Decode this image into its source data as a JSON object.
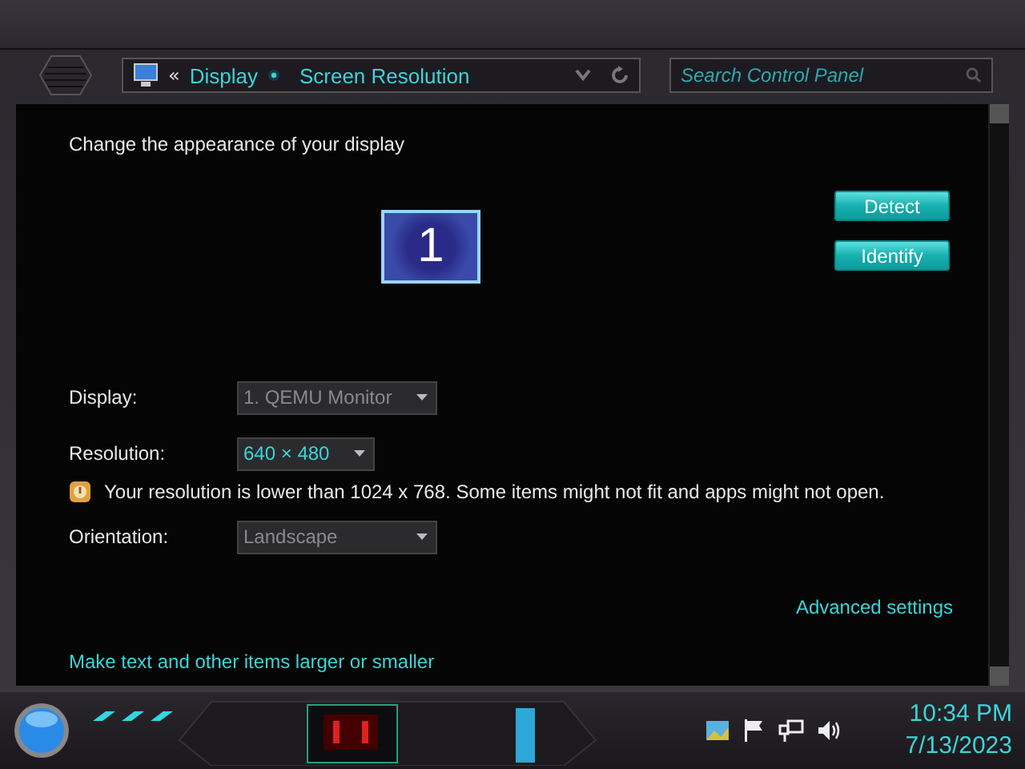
{
  "address_bar": {
    "back_glyph": "«",
    "breadcrumbs": [
      {
        "label": "Display"
      },
      {
        "label": "Screen Resolution"
      }
    ]
  },
  "search": {
    "placeholder": "Search Control Panel"
  },
  "content": {
    "heading": "Change the appearance of your display",
    "monitor": {
      "label": "1",
      "selected": true
    },
    "buttons": [
      "Detect",
      "Identify"
    ],
    "rows": [
      {
        "kind": "select",
        "label": "Display:",
        "value": "1. QEMU Monitor",
        "disabled": true
      },
      {
        "kind": "select",
        "label": "Resolution:",
        "value": "640 × 480",
        "disabled": false
      },
      {
        "kind": "warning",
        "text": "Your resolution is lower than 1024 x 768. Some items might not fit and apps might not open."
      },
      {
        "kind": "select",
        "label": "Orientation:",
        "value": "Landscape",
        "disabled": true
      }
    ],
    "advanced_link": "Advanced settings",
    "links": [
      "Make text and other items larger or smaller"
    ]
  },
  "taskbar": {
    "clock": {
      "time": "10:34 PM",
      "date": "7/13/2023"
    }
  }
}
